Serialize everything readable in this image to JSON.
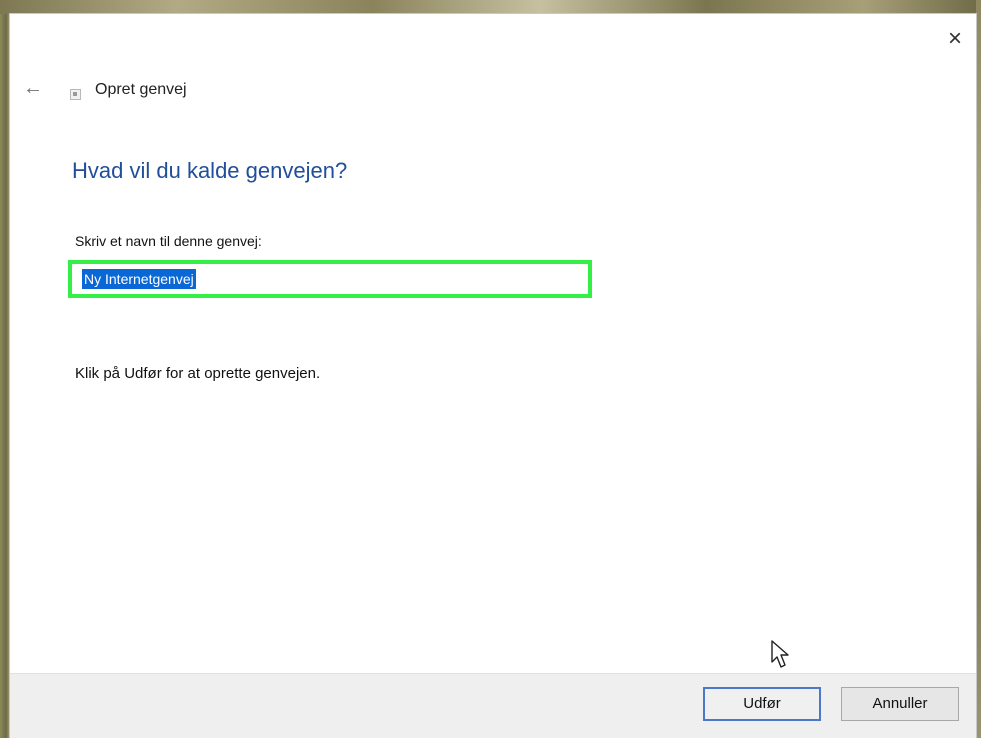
{
  "window": {
    "title": "Opret genvej",
    "close_icon": "close-icon",
    "back_icon": "back-arrow-icon",
    "wizard_icon": "shortcut-icon"
  },
  "page": {
    "heading": "Hvad vil du kalde genvejen?",
    "field_label": "Skriv et navn til denne genvej:",
    "name_value": "Ny Internetgenvej",
    "instruction": "Klik på Udfør for at oprette genvejen."
  },
  "footer": {
    "finish_label": "Udfør",
    "cancel_label": "Annuller"
  },
  "colors": {
    "heading": "#1f4f9a",
    "highlight_border": "#34ef46",
    "selection": "#0a67d6"
  }
}
